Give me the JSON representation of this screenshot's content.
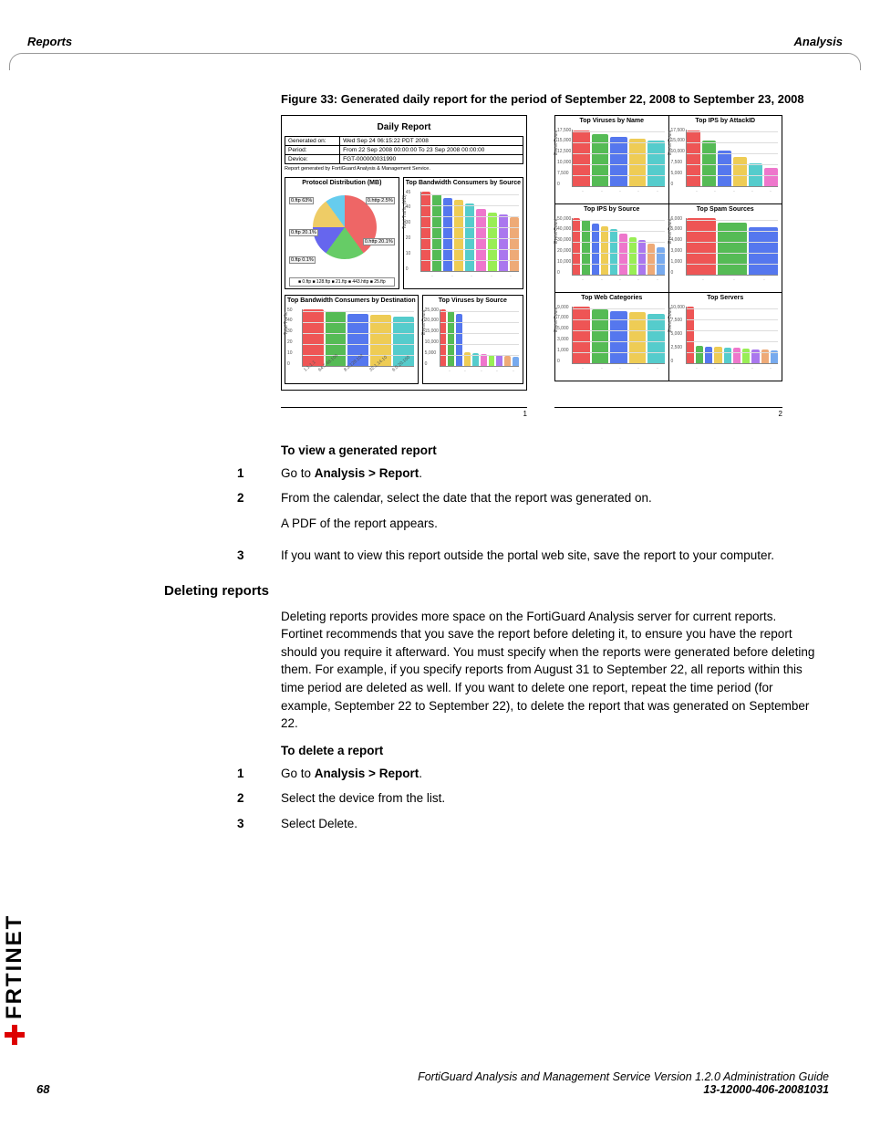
{
  "header": {
    "left": "Reports",
    "right": "Analysis"
  },
  "figure": {
    "caption": "Figure 33: Generated daily report for the period of September 22, 2008 to September 23, 2008",
    "report_title": "Daily Report",
    "info": {
      "gen_label": "Generated on:",
      "gen_value": "Wed Sep 24 06:15:22 PDT 2008",
      "period_label": "Period:",
      "period_value": "From 22 Sep 2008 00:00:00 To 23 Sep 2008 00:00:00",
      "device_label": "Device:",
      "device_value": "FGT-000000031990"
    },
    "gen_note": "Report generated by FortiGuard Analysis & Management Service.",
    "charts": {
      "protocol": "Protocol Distribution (MB)",
      "bw_src": "Top Bandwidth Consumers by Source",
      "bw_dst": "Top Bandwidth Consumers by Destination",
      "vir_src": "Top Viruses by Source",
      "vir_name": "Top Viruses by Name",
      "ips_attack": "Top IPS by AttackID",
      "ips_src": "Top IPS by Source",
      "spam": "Top Spam Sources",
      "web": "Top Web Categories",
      "servers": "Top Servers"
    },
    "pie_labels": {
      "a": "0.ftp\n63%",
      "b": "0.http\n2.5%",
      "c": "0.ftp\n20.1%",
      "d": "0.http\n20.1%",
      "e": "0.ftp\n0.1%"
    },
    "pie_legend": "■ 0.ftp ■ 128.ftp ■ 21.ftp ■ 443.http ■ 25.ftp",
    "page1": "1",
    "page2": "2"
  },
  "proc_view": {
    "title": "To view a generated report",
    "s1_pre": "Go to ",
    "s1_b": "Analysis > Report",
    "s1_post": ".",
    "s2": "From the calendar, select the date that the report was generated on.",
    "s2_note": "A PDF of the report appears.",
    "s3": "If you want to view this report outside the portal web site, save the report to your computer."
  },
  "deleting": {
    "heading": "Deleting reports",
    "para": "Deleting reports provides more space on the FortiGuard Analysis server for current reports. Fortinet recommends that you save the report before deleting it, to ensure you have the report should you require it afterward. You must specify when the reports were generated before deleting them. For example, if you specify reports from August 31 to September 22, all reports within this time period are deleted as well. If you want to delete one report, repeat the time period (for example, September 22 to September 22), to delete the report that was generated on September 22."
  },
  "proc_delete": {
    "title": "To delete a report",
    "s1_pre": "Go to ",
    "s1_b": "Analysis > Report",
    "s1_post": ".",
    "s2": "Select the device from the list.",
    "s3": "Select Delete."
  },
  "footer": {
    "line1": "FortiGuard Analysis and Management Service Version 1.2.0 Administration Guide",
    "line2": "13-12000-406-20081031",
    "page": "68"
  },
  "brand": "RTINET",
  "chart_data": [
    {
      "type": "pie",
      "title": "Protocol Distribution (MB)",
      "series": [
        {
          "name": "0.ftp",
          "value": 63
        },
        {
          "name": "0.http",
          "value": 2.5
        },
        {
          "name": "0.ftp",
          "value": 20.1
        },
        {
          "name": "128.ftp",
          "value": 10
        },
        {
          "name": "25.ftp",
          "value": 4.4
        }
      ]
    },
    {
      "type": "bar",
      "title": "Top Bandwidth Consumers by Source",
      "ylabel": "Total Traffic (MB)",
      "ylim": [
        0,
        45
      ],
      "categories": [
        "",
        "",
        "",
        "",
        "",
        "",
        "",
        "",
        ""
      ],
      "values": [
        45,
        43,
        41,
        40,
        38,
        35,
        33,
        32,
        30
      ]
    },
    {
      "type": "bar",
      "title": "Top Bandwidth Consumers by Destination",
      "ylabel": "Total Traffic",
      "ylim": [
        0,
        50
      ],
      "categories": [
        "1.1.1.1",
        "64.7.48.100",
        "8.3.128.102",
        "32.1.14.10",
        "6.0.20.100"
      ],
      "values": [
        50,
        48,
        46,
        45,
        43
      ]
    },
    {
      "type": "bar",
      "title": "Top Viruses by Source",
      "ylabel": "Event Count",
      "ylim": [
        0,
        25000
      ],
      "categories": [
        "",
        "",
        "",
        "",
        "",
        "",
        "",
        "",
        "",
        ""
      ],
      "values": [
        25000,
        24000,
        23000,
        6000,
        5500,
        5000,
        4800,
        4500,
        4200,
        4000
      ]
    },
    {
      "type": "bar",
      "title": "Top Viruses by Name",
      "ylabel": "Event Count",
      "ylim": [
        0,
        17500
      ],
      "categories": [
        "",
        "",
        "",
        "",
        ""
      ],
      "values": [
        17000,
        16000,
        15000,
        14500,
        14000
      ]
    },
    {
      "type": "bar",
      "title": "Top IPS by AttackID",
      "ylabel": "Event Count",
      "ylim": [
        0,
        17500
      ],
      "categories": [
        "",
        "",
        "",
        "",
        "",
        ""
      ],
      "values": [
        17000,
        14000,
        11000,
        9000,
        7000,
        5500
      ]
    },
    {
      "type": "bar",
      "title": "Top IPS by Source",
      "ylabel": "Event Count",
      "ylim": [
        0,
        50000
      ],
      "categories": [
        "",
        "",
        "",
        "",
        "",
        "",
        "",
        "",
        "",
        ""
      ],
      "values": [
        50000,
        48000,
        45000,
        42000,
        40000,
        36000,
        33000,
        30000,
        27000,
        24000
      ]
    },
    {
      "type": "bar",
      "title": "Top Spam Sources",
      "ylabel": "Event Count",
      "ylim": [
        0,
        6000
      ],
      "categories": [
        "",
        "",
        ""
      ],
      "values": [
        6000,
        5500,
        5000
      ]
    },
    {
      "type": "bar",
      "title": "Top Web Categories",
      "ylabel": "Event Count",
      "ylim": [
        0,
        9000
      ],
      "categories": [
        "",
        "",
        "",
        "",
        ""
      ],
      "values": [
        9000,
        8500,
        8200,
        8000,
        7800
      ]
    },
    {
      "type": "bar",
      "title": "Top Servers",
      "ylabel": "Event Count",
      "ylim": [
        0,
        10000
      ],
      "categories": [
        "",
        "",
        "",
        "",
        "",
        "",
        "",
        "",
        "",
        ""
      ],
      "values": [
        10000,
        3000,
        2900,
        2800,
        2700,
        2600,
        2500,
        2400,
        2300,
        2200
      ]
    }
  ]
}
